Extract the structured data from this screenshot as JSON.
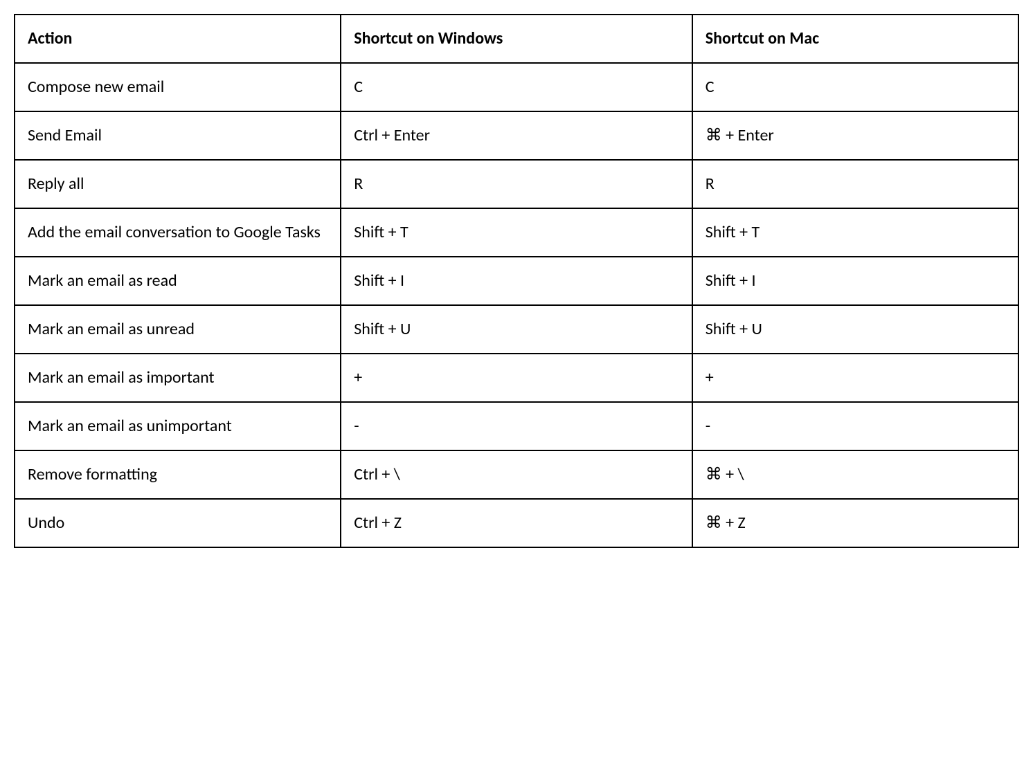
{
  "chart_data": {
    "type": "table",
    "headers": [
      "Action",
      "Shortcut on Windows",
      "Shortcut on Mac"
    ],
    "rows": [
      {
        "action": "Compose new email",
        "windows": "C",
        "mac": "C"
      },
      {
        "action": "Send Email",
        "windows": "Ctrl + Enter",
        "mac": "⌘ + Enter"
      },
      {
        "action": "Reply all",
        "windows": "R",
        "mac": "R"
      },
      {
        "action": "Add the email conversation to Google Tasks",
        "windows": "Shift + T",
        "mac": "Shift + T"
      },
      {
        "action": "Mark an email as read",
        "windows": "Shift + I",
        "mac": "Shift + I"
      },
      {
        "action": "Mark an email as unread",
        "windows": "Shift + U",
        "mac": "Shift + U"
      },
      {
        "action": "Mark an email as important",
        "windows": "+",
        "mac": "+"
      },
      {
        "action": "Mark an email as unimportant",
        "windows": "-",
        "mac": "-"
      },
      {
        "action": "Remove formatting",
        "windows": "Ctrl + \\",
        "mac": "⌘ + \\"
      },
      {
        "action": "Undo",
        "windows": "Ctrl + Z",
        "mac": "⌘ + Z"
      }
    ]
  }
}
